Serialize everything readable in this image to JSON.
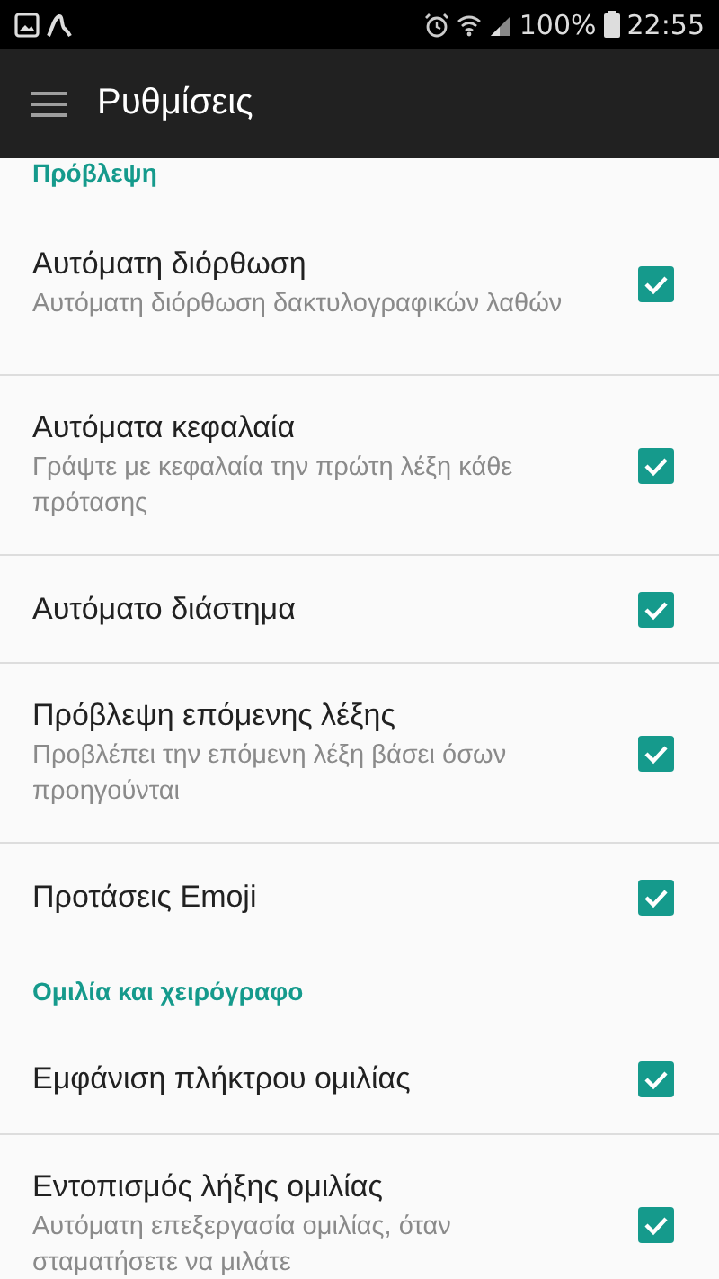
{
  "status_bar": {
    "battery": "100%",
    "time": "22:55"
  },
  "toolbar": {
    "title": "Ρυθμίσεις"
  },
  "items": [
    {
      "kind": "header",
      "title": "Πρόβλεψη"
    },
    {
      "kind": "checkbox",
      "title": "Αυτόματη διόρθωση",
      "summary": "Αυτόματη διόρθωση δακτυλογραφικών λαθών",
      "checked": true
    },
    {
      "kind": "checkbox",
      "title": "Αυτόματα κεφαλαία",
      "summary": "Γράψτε με κεφαλαία την πρώτη λέξη κάθε πρότασης",
      "checked": true
    },
    {
      "kind": "checkbox",
      "title": "Αυτόματο διάστημα",
      "checked": true
    },
    {
      "kind": "checkbox",
      "title": "Πρόβλεψη επόμενης λέξης",
      "summary": "Προβλέπει την επόμενη λέξη βάσει όσων προηγούνται",
      "checked": true
    },
    {
      "kind": "checkbox",
      "title": "Προτάσεις Emoji",
      "checked": true
    },
    {
      "kind": "header",
      "title": "Ομιλία και χειρόγραφο"
    },
    {
      "kind": "checkbox",
      "title": "Εμφάνιση πλήκτρου ομιλίας",
      "checked": true
    },
    {
      "kind": "checkbox",
      "title": "Εντοπισμός λήξης ομιλίας",
      "summary": "Αυτόματη επεξεργασία ομιλίας, όταν σταματήσετε να μιλάτε",
      "checked": true
    }
  ]
}
